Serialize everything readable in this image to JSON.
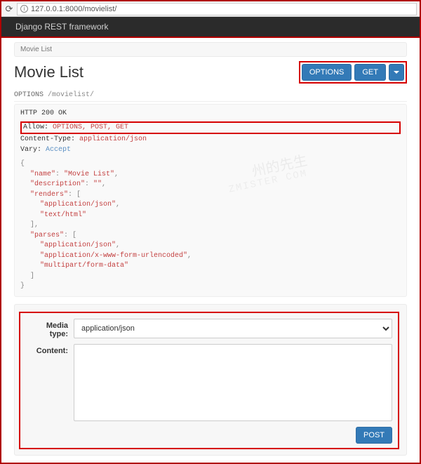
{
  "address_bar": {
    "url_text": "127.0.0.1:8000/movielist/"
  },
  "navbar": {
    "brand": "Django REST framework"
  },
  "breadcrumb": {
    "text": "Movie List"
  },
  "page": {
    "title": "Movie List"
  },
  "buttons": {
    "options": "OPTIONS",
    "get": "GET",
    "post": "POST"
  },
  "request": {
    "method": "OPTIONS",
    "path": "/movielist/"
  },
  "response": {
    "status": "HTTP 200 OK",
    "headers": {
      "allow_key": "Allow:",
      "allow_val": "OPTIONS, POST, GET",
      "ctype_key": "Content-Type:",
      "ctype_val": "application/json",
      "vary_key": "Vary:",
      "vary_val": "Accept"
    },
    "body": {
      "name_key": "\"name\"",
      "name_val": "\"Movie List\"",
      "desc_key": "\"description\"",
      "desc_val": "\"\"",
      "renders_key": "\"renders\"",
      "renders_0": "\"application/json\"",
      "renders_1": "\"text/html\"",
      "parses_key": "\"parses\"",
      "parses_0": "\"application/json\"",
      "parses_1": "\"application/x-www-form-urlencoded\"",
      "parses_2": "\"multipart/form-data\""
    }
  },
  "form": {
    "media_label": "Media type:",
    "content_label": "Content:",
    "media_options": [
      "application/json"
    ]
  },
  "watermark": {
    "top": "州的先生",
    "bottom": "ZMISTER COM"
  }
}
